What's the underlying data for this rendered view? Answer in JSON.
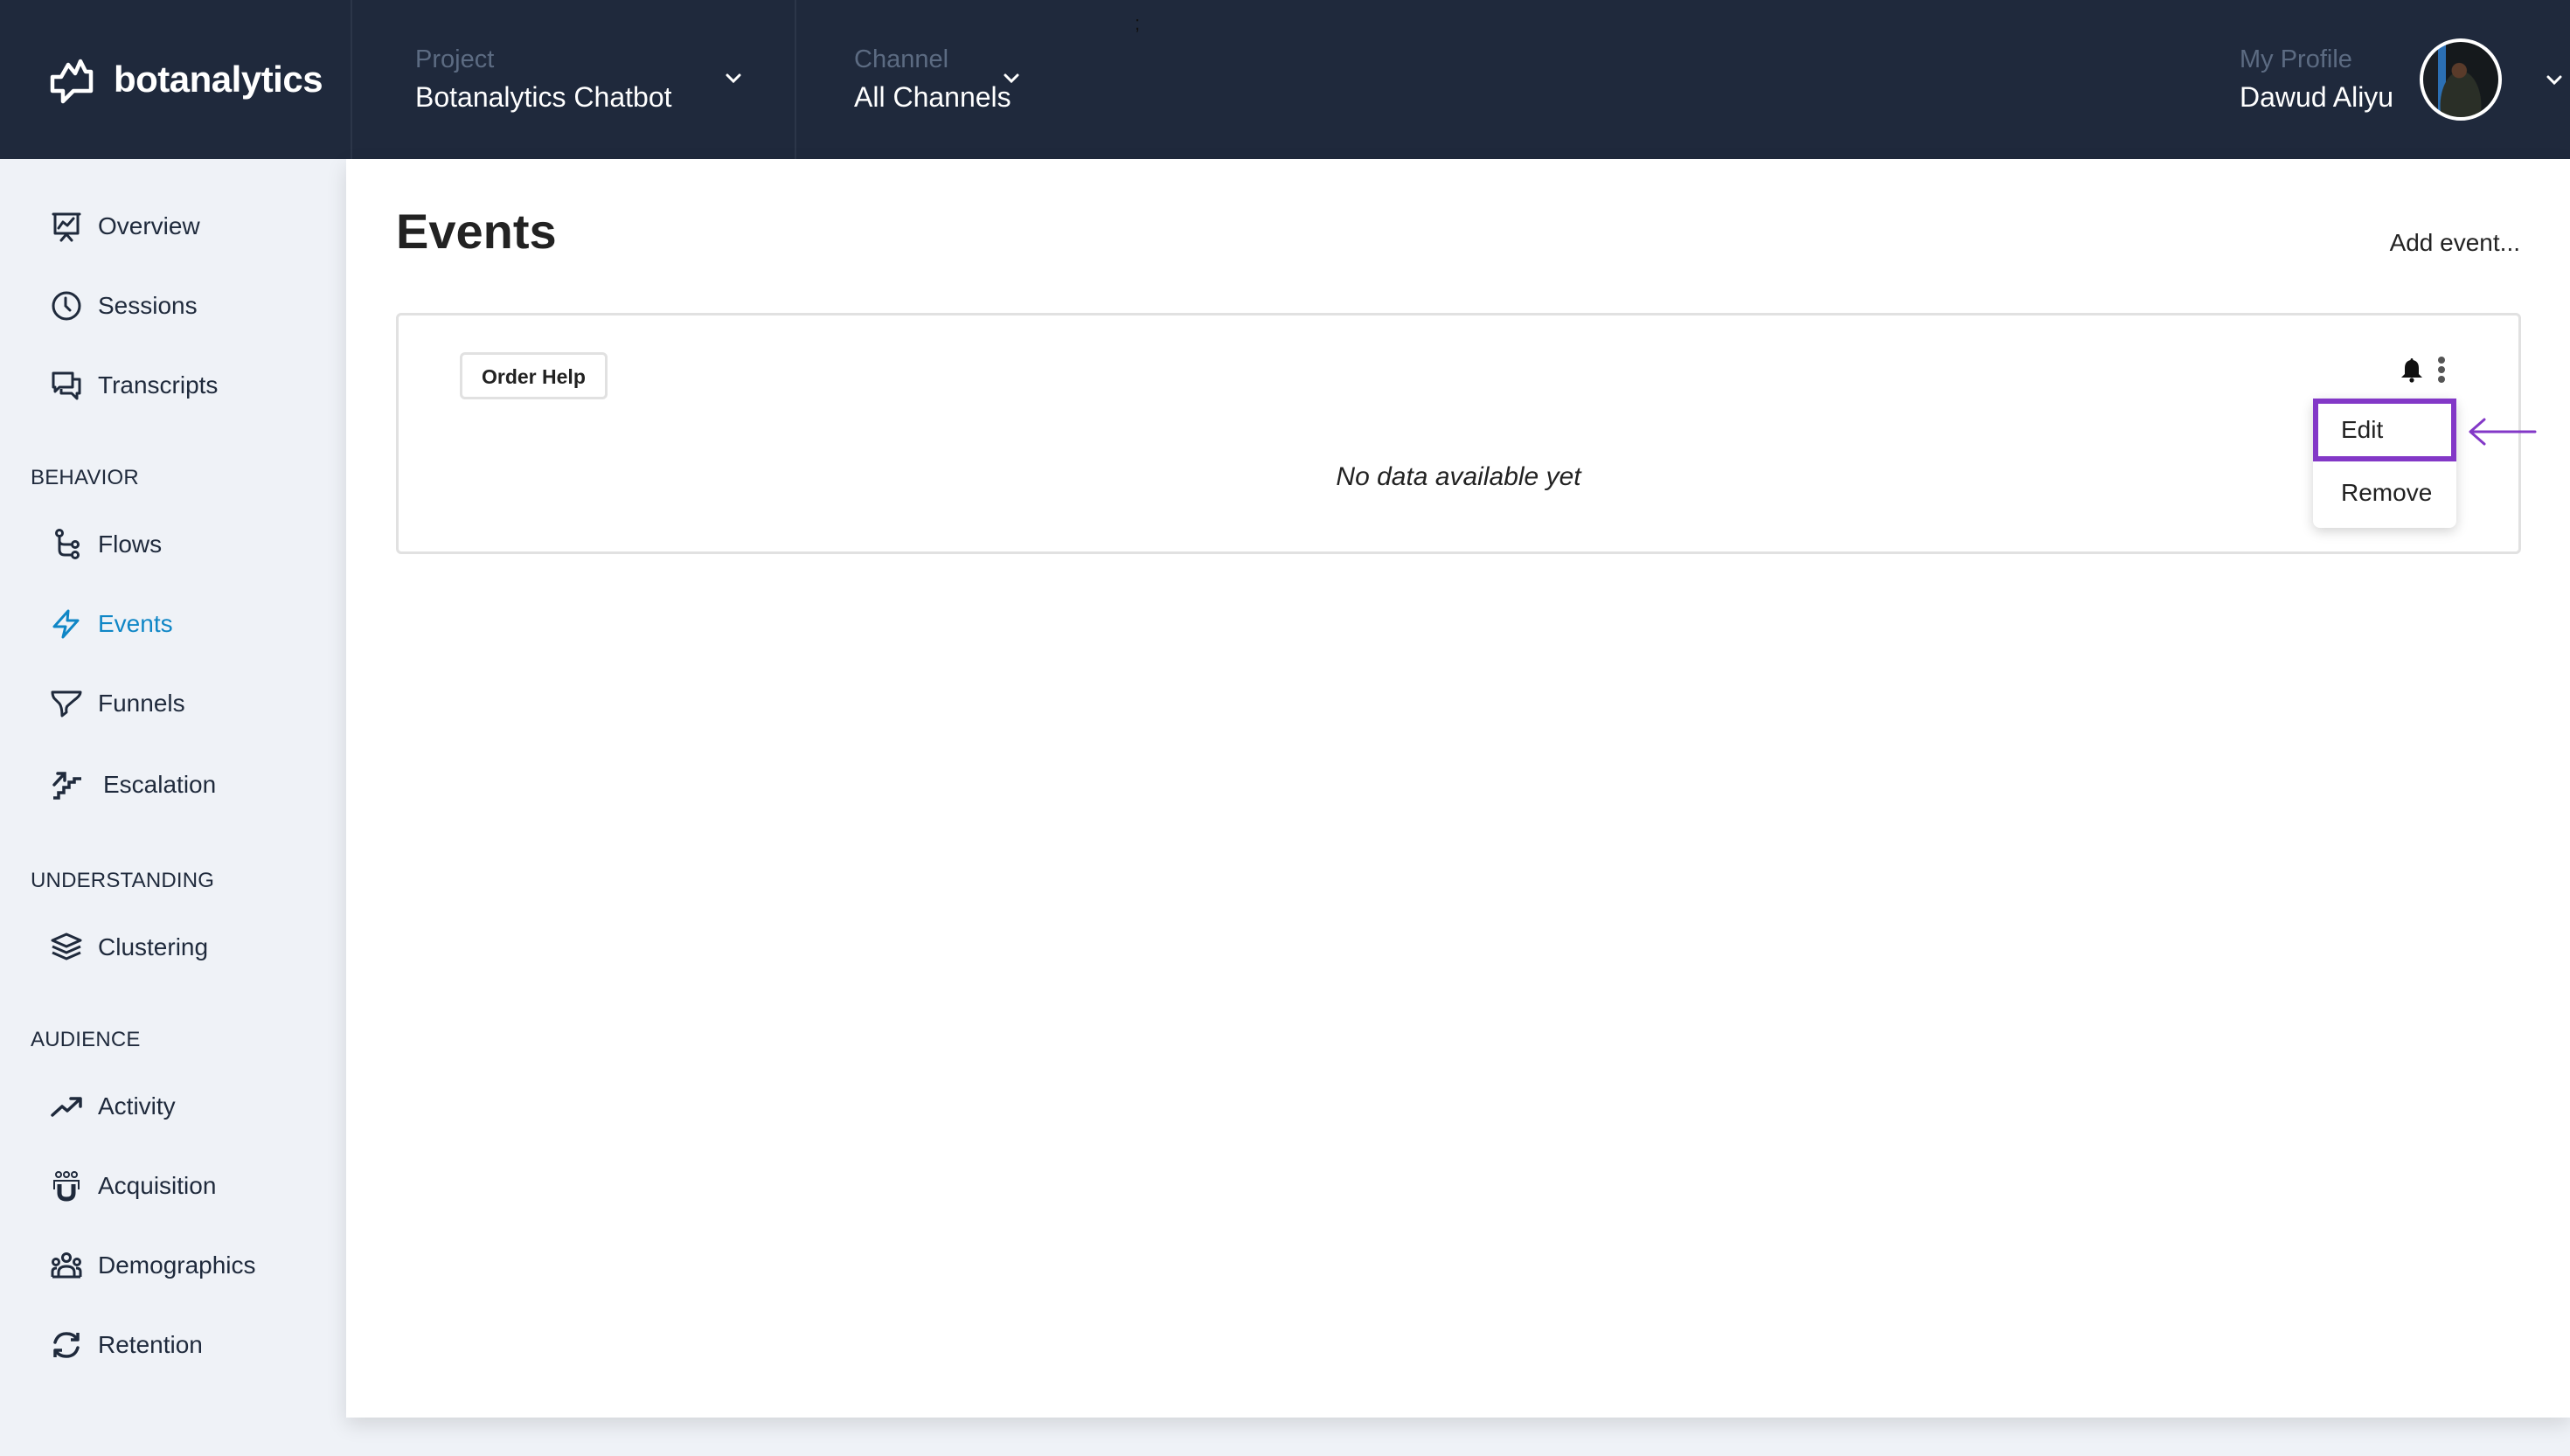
{
  "header": {
    "brand": "botanalytics",
    "project": {
      "label": "Project",
      "value": "Botanalytics Chatbot"
    },
    "channel": {
      "label": "Channel",
      "value": "All Channels"
    },
    "profile": {
      "label": "My Profile",
      "name": "Dawud Aliyu"
    },
    "stray_mark": ";"
  },
  "sidebar": {
    "items": [
      {
        "label": "Overview",
        "icon": "presentation-chart-icon"
      },
      {
        "label": "Sessions",
        "icon": "clock-icon"
      },
      {
        "label": "Transcripts",
        "icon": "chat-bubbles-icon"
      }
    ],
    "sections": [
      {
        "title": "BEHAVIOR",
        "items": [
          {
            "label": "Flows",
            "icon": "git-branch-icon"
          },
          {
            "label": "Events",
            "icon": "lightning-icon",
            "active": true
          },
          {
            "label": "Funnels",
            "icon": "funnel-icon"
          },
          {
            "label": "Escalation",
            "icon": "stairs-arrow-icon"
          }
        ]
      },
      {
        "title": "UNDERSTANDING",
        "items": [
          {
            "label": "Clustering",
            "icon": "layers-icon"
          }
        ]
      },
      {
        "title": "AUDIENCE",
        "items": [
          {
            "label": "Activity",
            "icon": "trending-up-icon"
          },
          {
            "label": "Acquisition",
            "icon": "magnet-users-icon"
          },
          {
            "label": "Demographics",
            "icon": "users-group-icon"
          },
          {
            "label": "Retention",
            "icon": "refresh-icon"
          }
        ]
      }
    ]
  },
  "main": {
    "title": "Events",
    "add_event": "Add event...",
    "event_card": {
      "tag": "Order Help",
      "empty_message": "No data available yet",
      "menu": [
        {
          "label": "Edit",
          "highlighted": true
        },
        {
          "label": "Remove"
        }
      ]
    }
  },
  "colors": {
    "topbar": "#1f293c",
    "active_nav": "#0f86c6",
    "highlight": "#8338c7",
    "sidebar_bg": "#eff2f7"
  }
}
